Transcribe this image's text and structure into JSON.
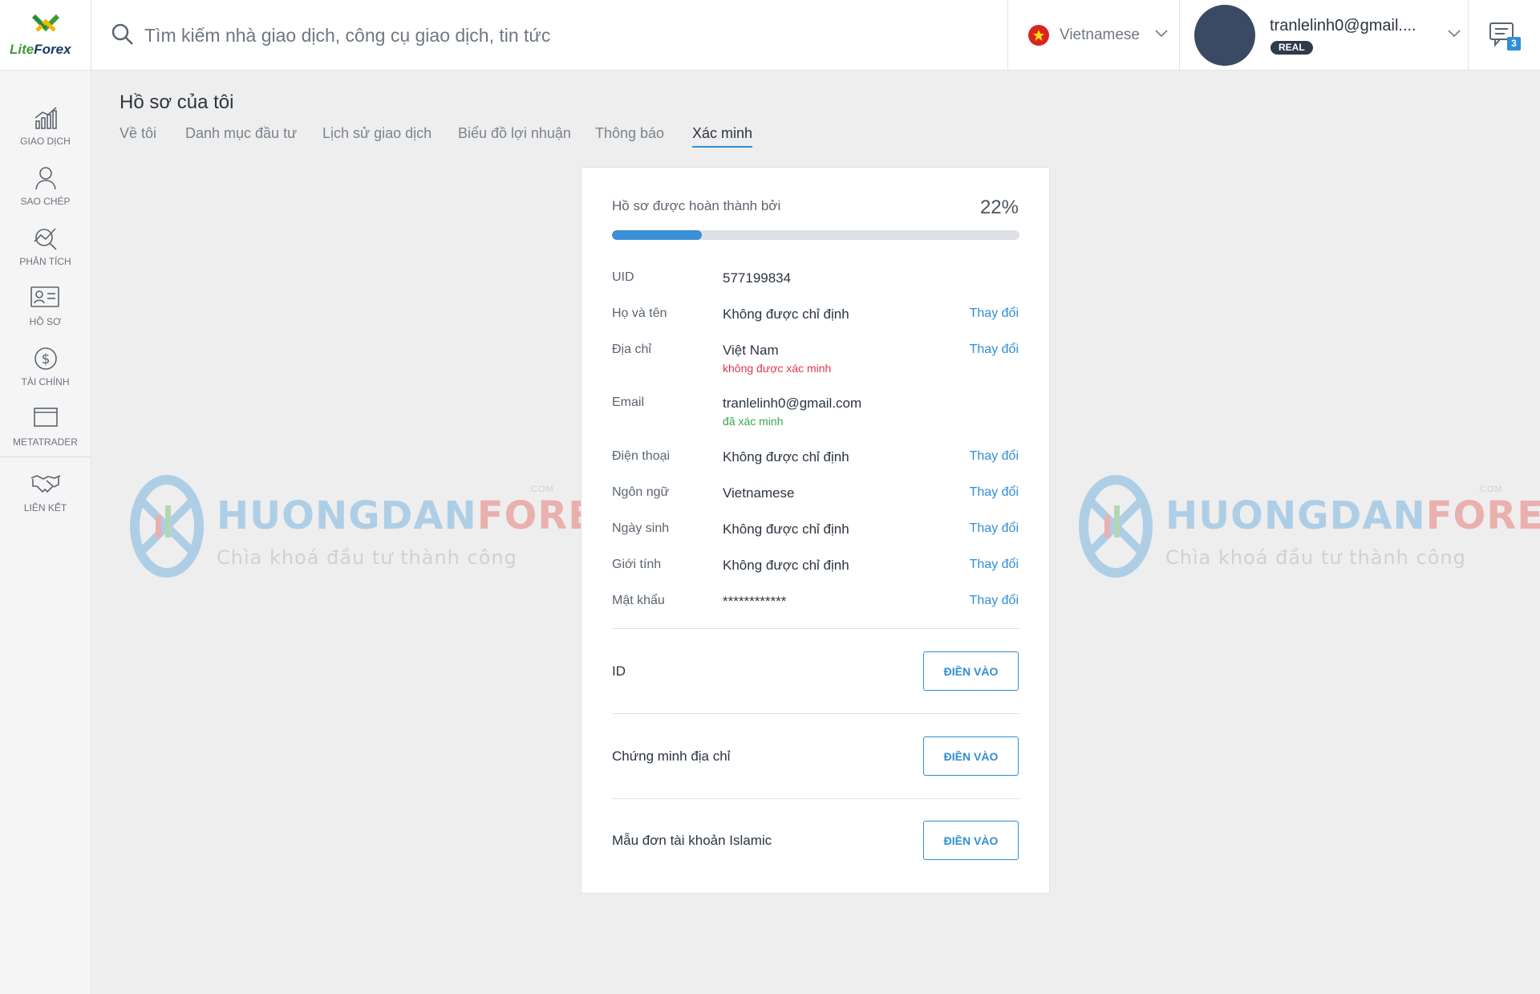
{
  "brand": {
    "logo_part1": "Lite",
    "logo_part2": "Forex"
  },
  "search": {
    "placeholder": "Tìm kiếm nhà giao dịch, công cụ giao dịch, tin tức"
  },
  "language": {
    "selected": "Vietnamese",
    "flag_icon": "vietnam-flag-icon"
  },
  "user": {
    "email": "tranlelinh0@gmail....",
    "account_type": "REAL"
  },
  "notifications": {
    "count": "3"
  },
  "sidebar": {
    "items": [
      {
        "label": "GIAO DỊCH",
        "icon": "trade-chart-icon"
      },
      {
        "label": "SAO CHÉP",
        "icon": "copy-user-icon"
      },
      {
        "label": "PHÂN TÍCH",
        "icon": "analysis-icon"
      },
      {
        "label": "HỒ SƠ",
        "icon": "profile-card-icon"
      },
      {
        "label": "TÀI CHÍNH",
        "icon": "dollar-icon"
      },
      {
        "label": "METATRADER",
        "icon": "window-icon"
      },
      {
        "label": "LIÊN KẾT",
        "icon": "handshake-icon"
      }
    ]
  },
  "page": {
    "title": "Hồ sơ của tôi",
    "tabs": [
      {
        "label": "Về tôi",
        "active": false
      },
      {
        "label": "Danh mục đầu tư",
        "active": false
      },
      {
        "label": "Lịch sử giao dịch",
        "active": false
      },
      {
        "label": "Biểu đồ lợi nhuận",
        "active": false
      },
      {
        "label": "Thông báo",
        "active": false
      },
      {
        "label": "Xác minh",
        "active": true
      }
    ]
  },
  "watermark": {
    "brand_part1": "HUONGDAN",
    "brand_part2": "FOREX",
    "com": ".COM",
    "slogan": "Chìa khoá đầu tư thành công"
  },
  "profile": {
    "completion_label": "Hồ sơ được hoàn thành bởi",
    "completion_percent": "22%",
    "completion_value": 22,
    "fields": [
      {
        "label": "UID",
        "value": "577199834"
      },
      {
        "label": "Họ và tên",
        "value": "Không được chỉ định",
        "action": "Thay đổi"
      },
      {
        "label": "Địa chỉ",
        "value": "Việt Nam",
        "status": "không được xác minh",
        "status_color": "#e2364f",
        "action": "Thay đổi"
      },
      {
        "label": "Email",
        "value": "tranlelinh0@gmail.com",
        "status": "đã xác minh",
        "status_color": "#3aa54b"
      },
      {
        "label": "Điện thoại",
        "value": "Không được chỉ định",
        "action": "Thay đổi"
      },
      {
        "label": "Ngôn ngữ",
        "value": "Vietnamese",
        "action": "Thay đổi"
      },
      {
        "label": "Ngày sinh",
        "value": "Không được chỉ định",
        "action": "Thay đổi"
      },
      {
        "label": "Giới tính",
        "value": "Không được chỉ định",
        "action": "Thay đổi"
      },
      {
        "label": "Mật khẩu",
        "value": "************",
        "action": "Thay đổi"
      }
    ],
    "documents": [
      {
        "label": "ID",
        "button": "ĐIỀN VÀO"
      },
      {
        "label": "Chứng minh địa chỉ",
        "button": "ĐIỀN VÀO"
      },
      {
        "label": "Mẫu đơn tài khoản Islamic",
        "button": "ĐIỀN VÀO"
      }
    ]
  },
  "colors": {
    "accent": "#2f8fd6",
    "error": "#e2364f",
    "success": "#3aa54b",
    "background": "#eeeeee"
  }
}
